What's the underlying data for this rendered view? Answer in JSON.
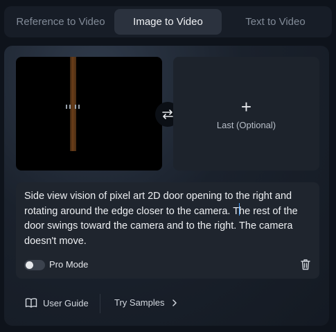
{
  "tabs": [
    {
      "label": "Reference to Video",
      "active": false
    },
    {
      "label": "Image to Video",
      "active": true
    },
    {
      "label": "Text to Video",
      "active": false
    }
  ],
  "frames": {
    "last_label": "Last (Optional)",
    "plus_symbol": "+"
  },
  "prompt": {
    "text": "Side view vision of pixel art 2D door opening to the right and rotating around the edge closer to the camera. The rest of the door swings toward the camera and to the right. The camera doesn't move."
  },
  "pro_mode": {
    "label": "Pro Mode",
    "enabled": false
  },
  "footer": {
    "user_guide_label": "User Guide",
    "try_samples_label": "Try Samples"
  },
  "icons": {
    "swap": "swap-arrows-icon",
    "delete": "trash-icon",
    "guide": "book-icon",
    "chevron": "chevron-right-icon"
  },
  "colors": {
    "background": "#0e131b",
    "active_tab": "#2b323e",
    "prompt_box": "#1f252e",
    "door": "#6a3e19",
    "caret": "#4da3ff"
  }
}
